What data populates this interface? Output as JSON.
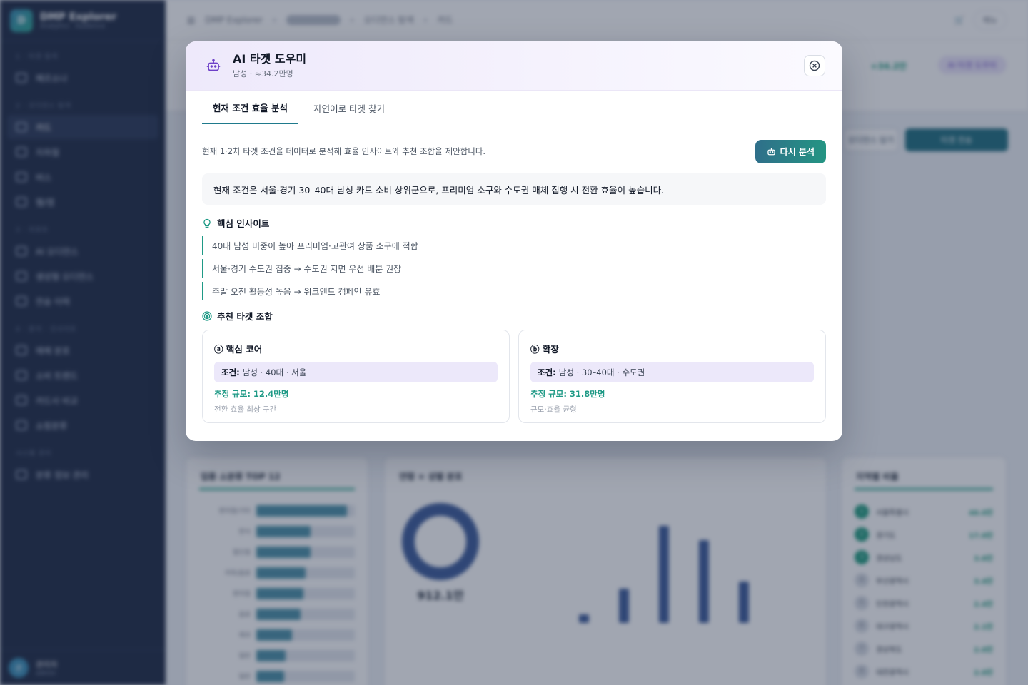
{
  "modal": {
    "title": "AI 타겟 도우미",
    "subtitle": "남성 · ≈34.2만명",
    "tabs": [
      {
        "label": "현재 조건 효율 분석",
        "active": true
      },
      {
        "label": "자연어로 타겟 찾기",
        "active": false
      }
    ],
    "intro": "현재 1·2차 타겟 조건을 데이터로 분석해 효율 인사이트와 추천 조합을 제안합니다.",
    "reanalyze_label": "다시 분석",
    "summary": "현재 조건은 서울·경기 30–40대 남성 카드 소비 상위군으로, 프리미엄 소구와 수도권 매체 집행 시 전환 효율이 높습니다.",
    "insights_title": "핵심 인사이트",
    "insights": [
      "40대 남성 비중이 높아 프리미엄·고관여 상품 소구에 적합",
      "서울·경기 수도권 집중 → 수도권 지면 우선 배분 권장",
      "주말 오전 활동성 높음 → 위크엔드 캠페인 유효"
    ],
    "combos_title": "추천 타겟 조합",
    "combos": [
      {
        "title": "ⓐ 핵심 코어",
        "cond_label": "조건:",
        "cond": "남성 · 40대 · 서울",
        "size": "추정 규모: 12.4만명",
        "note": "전환 효율 최상 구간"
      },
      {
        "title": "ⓑ 확장",
        "cond_label": "조건:",
        "cond": "남성 · 30–40대 · 수도권",
        "size": "추정 규모: 31.8만명",
        "note": "규모·효율 균형"
      }
    ]
  },
  "background": {
    "brand_name": "DMP Explorer",
    "brand_sub": "Analytics · Audience",
    "breadcrumb": [
      "DMP Explorer",
      "오디언스 탐색",
      "카드"
    ],
    "nav_sections": [
      {
        "title": "1 · 타겟 탐색",
        "items": [
          "페르소나"
        ]
      },
      {
        "title": "2 · 오디언스 탐색",
        "items": [
          "카드",
          "지하철",
          "버스",
          "웹/앱"
        ]
      },
      {
        "title": "3 · 리포트",
        "items": [
          "AI 오디언스",
          "생성형 오디언스",
          "전송 이력"
        ]
      },
      {
        "title": "4 · 분석 · 인사이트",
        "items": [
          "매체 분포",
          "소비 트렌드",
          "카드사 비교",
          "쇼핑분류"
        ]
      },
      {
        "title": "시스템 관리",
        "items": [
          "분류 정보 관리"
        ]
      }
    ],
    "user_name": "관리자",
    "user_role": "admin",
    "header_chip": "AI 타겟 도우미",
    "header_count": "+34.2만",
    "top_button": "메뉴",
    "action_primary": "타겟 전송",
    "action_secondary": "오디언스 담기",
    "card1_title": "업종 소분류 TOP 12",
    "card2_title": "연령 × 성별 분포",
    "card2_total": "912.1만",
    "card3_title": "지역별 비율",
    "hbars": [
      {
        "label": "편의점/기타",
        "value": 0.92
      },
      {
        "label": "한식",
        "value": 0.55
      },
      {
        "label": "할인점",
        "value": 0.55
      },
      {
        "label": "커피/음료",
        "value": 0.5
      },
      {
        "label": "편의점",
        "value": 0.48
      },
      {
        "label": "음료",
        "value": 0.45
      },
      {
        "label": "제과",
        "value": 0.36
      },
      {
        "label": "일반",
        "value": 0.3
      },
      {
        "label": "일반",
        "value": 0.28
      }
    ],
    "age_bars": [
      0.09,
      0.35,
      1.0,
      0.85,
      0.43
    ],
    "regions": [
      {
        "name": "서울특별시",
        "value": "46.0만"
      },
      {
        "name": "경기도",
        "value": "17.0만"
      },
      {
        "name": "경상남도",
        "value": "3.6만"
      },
      {
        "name": "부산광역시",
        "value": "3.4만"
      },
      {
        "name": "인천광역시",
        "value": "2.4만"
      },
      {
        "name": "대구광역시",
        "value": "2.1만"
      },
      {
        "name": "경상북도",
        "value": "2.0만"
      },
      {
        "name": "대전광역시",
        "value": "2.0만"
      }
    ]
  }
}
